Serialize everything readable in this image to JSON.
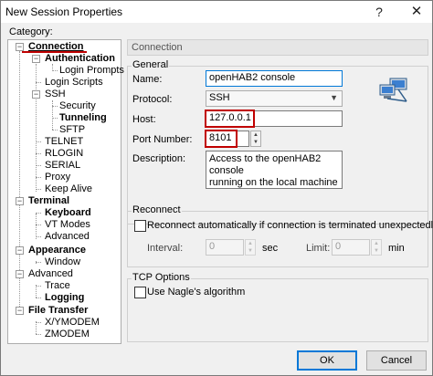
{
  "window": {
    "title": "New Session Properties",
    "help_glyph": "?",
    "close_glyph": "✕"
  },
  "category_label": "Category:",
  "tree": {
    "connection": "Connection",
    "authentication": "Authentication",
    "login_prompts": "Login Prompts",
    "login_scripts": "Login Scripts",
    "ssh": "SSH",
    "security": "Security",
    "tunneling": "Tunneling",
    "sftp": "SFTP",
    "telnet": "TELNET",
    "rlogin": "RLOGIN",
    "serial": "SERIAL",
    "proxy": "Proxy",
    "keep_alive": "Keep Alive",
    "terminal": "Terminal",
    "keyboard": "Keyboard",
    "vt_modes": "VT Modes",
    "advanced_term": "Advanced",
    "appearance": "Appearance",
    "window": "Window",
    "advanced": "Advanced",
    "trace": "Trace",
    "logging": "Logging",
    "file_transfer": "File Transfer",
    "xymodem": "X/YMODEM",
    "zmodem": "ZMODEM"
  },
  "panel": {
    "header": "Connection",
    "general": {
      "group_label": "General",
      "name_label": "Name:",
      "name_value": "openHAB2 console",
      "protocol_label": "Protocol:",
      "protocol_value": "SSH",
      "host_label": "Host:",
      "host_value": "127.0.0.1",
      "port_label": "Port Number:",
      "port_value": "8101",
      "description_label": "Description:",
      "description_line1": "Access to the openHAB2 console",
      "description_line2": "running on the local machine"
    },
    "reconnect": {
      "group_label": "Reconnect",
      "checkbox_label": "Reconnect automatically if connection is terminated unexpectedly",
      "interval_label": "Interval:",
      "interval_value": "0",
      "interval_unit": "sec",
      "limit_label": "Limit:",
      "limit_value": "0",
      "limit_unit": "min"
    },
    "tcp": {
      "group_label": "TCP Options",
      "checkbox_label": "Use Nagle's algorithm"
    }
  },
  "buttons": {
    "ok": "OK",
    "cancel": "Cancel"
  },
  "colors": {
    "highlight": "#c00000",
    "accent": "#0078d7"
  }
}
